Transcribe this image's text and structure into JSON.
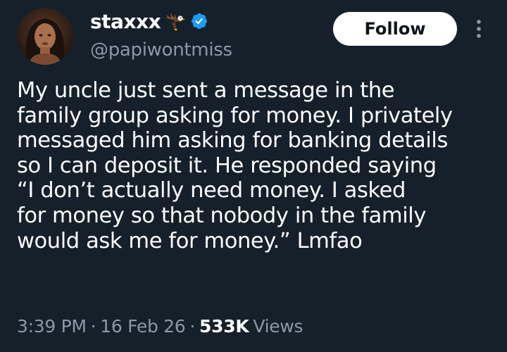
{
  "author": {
    "display_name": "staxxx",
    "handle": "@papiwontmiss",
    "avatar": "avatar",
    "emoji": "eagle-icon",
    "verified": "verified-badge-icon"
  },
  "actions": {
    "follow_label": "Follow",
    "more": "more-options-icon"
  },
  "tweet": {
    "lines": [
      "My uncle just sent a message in the",
      "family group asking for money. I privately",
      "messaged him asking for banking details",
      "so I can deposit it. He responded saying",
      "“I don’t actually need money. I asked",
      "for money so that nobody in the family",
      "would ask me for money.” Lmfao"
    ]
  },
  "meta": {
    "time": "3:39 PM",
    "separator": "·",
    "date": "16 Feb 26",
    "views_count": "533K",
    "views_label": "Views"
  },
  "colors": {
    "background": "#15202b",
    "text": "#ffffff",
    "secondary_text": "#8b98a5",
    "verified": "#1d9bf0",
    "follow_bg": "#ffffff"
  }
}
